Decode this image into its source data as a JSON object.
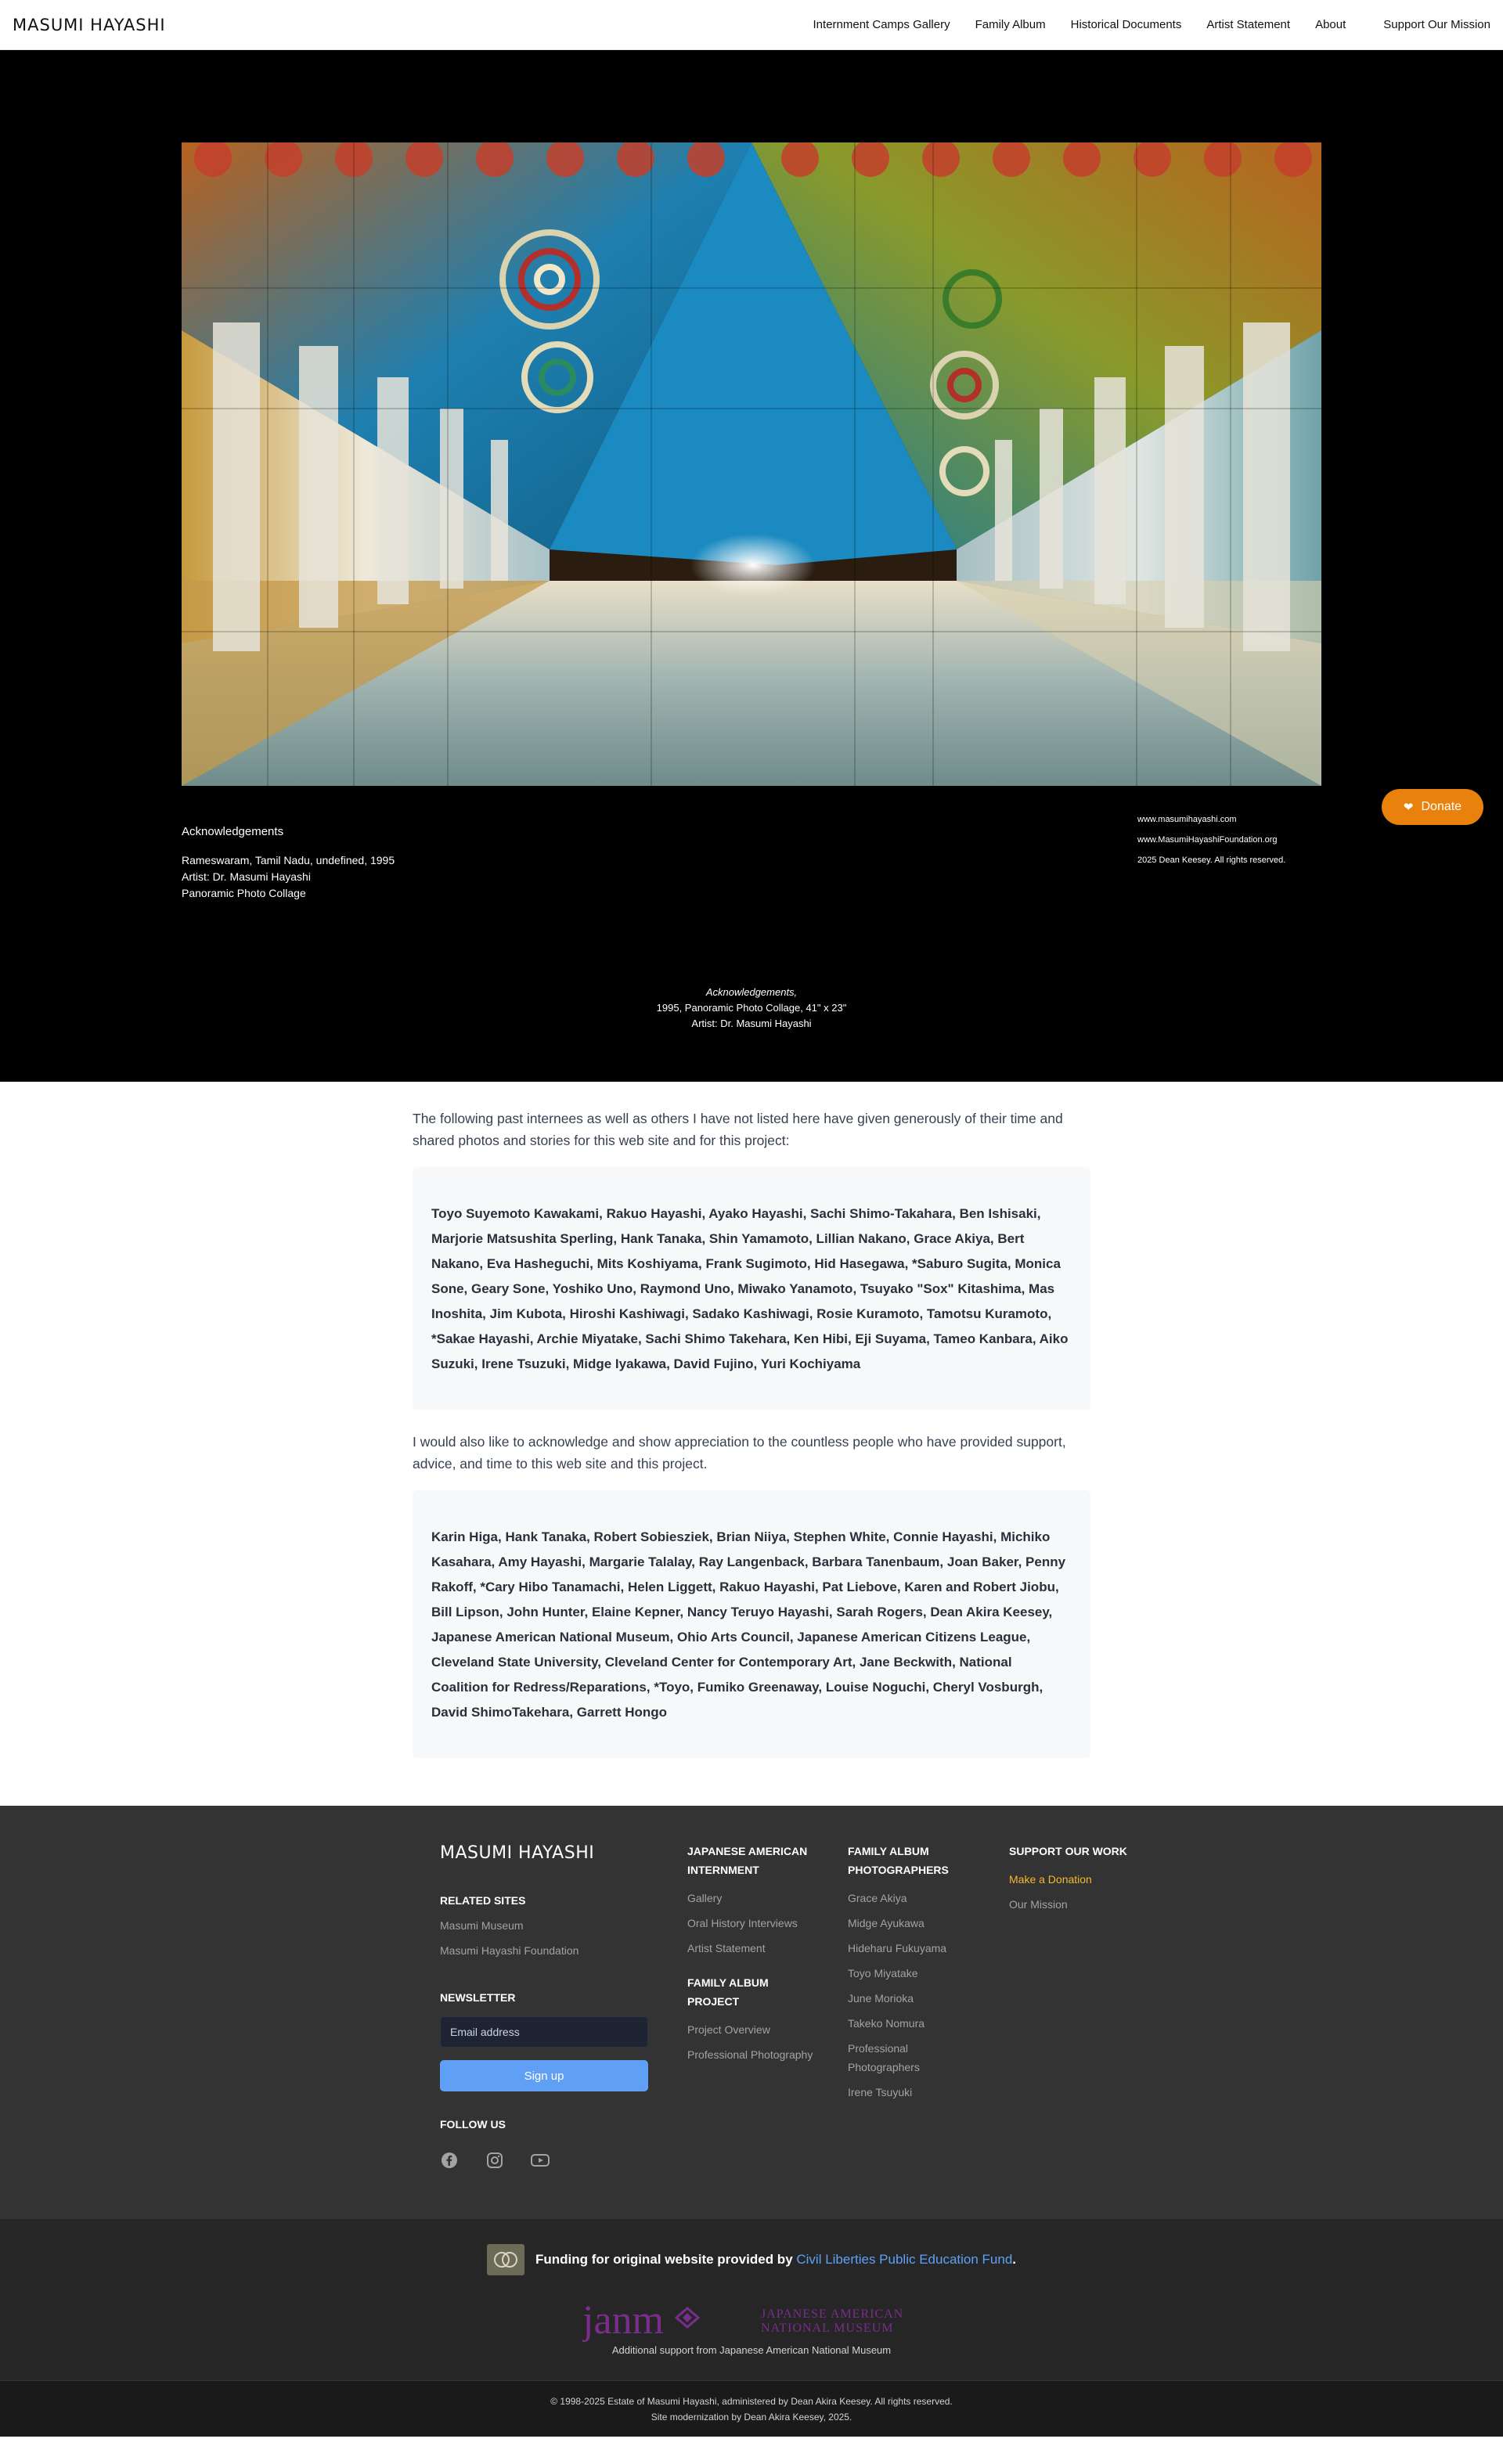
{
  "header": {
    "brand": "MASUMI HAYASHI",
    "nav": [
      "Internment Camps Gallery",
      "Family Album",
      "Historical Documents",
      "Artist Statement",
      "About"
    ],
    "mission": "Support Our Mission"
  },
  "hero": {
    "caption_title": "Acknowledgements",
    "caption_lines": [
      "Rameswaram, Tamil Nadu, undefined, 1995",
      "Artist: Dr. Masumi Hayashi",
      "Panoramic Photo Collage"
    ],
    "right_lines": [
      "www.masumihayashi.com",
      "www.MasumiHayashiFoundation.org",
      "2025 Dean Keesey. All rights reserved."
    ],
    "donate": "Donate",
    "center_title": "Acknowledgements,",
    "center_lines": [
      "1995, Panoramic Photo Collage, 41\" x 23\"",
      "Artist: Dr. Masumi Hayashi"
    ]
  },
  "content": {
    "intro": "The following past internees as well as others I have not listed here have given generously of their time and shared photos and stories for this web site and for this project:",
    "internees": "Toyo Suyemoto Kawakami, Rakuo Hayashi, Ayako Hayashi, Sachi Shimo-Takahara, Ben Ishisaki, Marjorie Matsushita Sperling, Hank Tanaka, Shin Yamamoto, Lillian Nakano, Grace Akiya, Bert Nakano, Eva Hasheguchi, Mits Koshiyama, Frank Sugimoto, Hid Hasegawa, *Saburo Sugita, Monica Sone, Geary Sone, Yoshiko Uno, Raymond Uno, Miwako Yanamoto, Tsuyako \"Sox\" Kitashima, Mas Inoshita, Jim Kubota, Hiroshi Kashiwagi, Sadako Kashiwagi, Rosie Kuramoto, Tamotsu Kuramoto, *Sakae Hayashi, Archie Miyatake, Sachi Shimo Takehara, Ken Hibi, Eji Suyama, Tameo Kanbara, Aiko Suzuki, Irene Tsuzuki, Midge Iyakawa, David Fujino, Yuri Kochiyama",
    "second": "I would also like to acknowledge and show appreciation to the countless people who have provided support, advice, and time to this web site and this project.",
    "supporters": "Karin Higa, Hank Tanaka, Robert Sobiesziek, Brian Niiya, Stephen White, Connie Hayashi, Michiko Kasahara, Amy Hayashi, Margarie Talalay, Ray Langenback, Barbara Tanenbaum, Joan Baker, Penny Rakoff, *Cary Hibo Tanamachi, Helen Liggett, Rakuo Hayashi, Pat Liebove, Karen and Robert Jiobu, Bill Lipson, John Hunter, Elaine Kepner, Nancy Teruyo Hayashi, Sarah Rogers, Dean Akira Keesey, Japanese American National Museum, Ohio Arts Council, Japanese American Citizens League, Cleveland State University, Cleveland Center for Contemporary Art, Jane Beckwith, National Coalition for Redress/Reparations, *Toyo, Fumiko Greenaway, Louise Noguchi, Cheryl Vosburgh, David ShimoTakehara, Garrett Hongo"
  },
  "footer": {
    "brand": "MASUMI HAYASHI",
    "related_head": "RELATED SITES",
    "related": [
      "Masumi Museum",
      "Masumi Hayashi Foundation"
    ],
    "newsletter_head": "NEWSLETTER",
    "email_placeholder": "Email address",
    "signup": "Sign up",
    "follow_head": "FOLLOW US",
    "internment_head": "JAPANESE AMERICAN INTERNMENT",
    "internment": [
      "Gallery",
      "Oral History Interviews",
      "Artist Statement"
    ],
    "project_head": "FAMILY ALBUM PROJECT",
    "project": [
      "Project Overview",
      "Professional Photography"
    ],
    "photographers_head": "FAMILY ALBUM PHOTOGRAPHERS",
    "photographers": [
      "Grace Akiya",
      "Midge Ayukawa",
      "Hideharu Fukuyama",
      "Toyo Miyatake",
      "June Morioka",
      "Takeko Nomura",
      "Professional Photographers",
      "Irene Tsuyuki"
    ],
    "support_head": "SUPPORT OUR WORK",
    "support_accent": "Make a Donation",
    "support": [
      "Our Mission"
    ],
    "funding_prefix": "Funding for original website provided by ",
    "funding_link": "Civil Liberties Public Education Fund",
    "funding_suffix": ".",
    "janm_logo_text": "janm",
    "janm_name_1": "JAPANESE AMERICAN",
    "janm_name_2": "NATIONAL MUSEUM",
    "janm_sub": "Additional support from Japanese American National Museum",
    "copyright_1": "© 1998-2025 Estate of Masumi Hayashi, administered by Dean Akira Keesey. All rights reserved.",
    "copyright_2": "Site modernization by Dean Akira Keesey, 2025."
  },
  "colors": {
    "accent_orange": "#e8820c",
    "link_blue": "#5fa0f4",
    "footer_accent": "#f5b82e",
    "janm_purple": "#7b2d8e"
  }
}
